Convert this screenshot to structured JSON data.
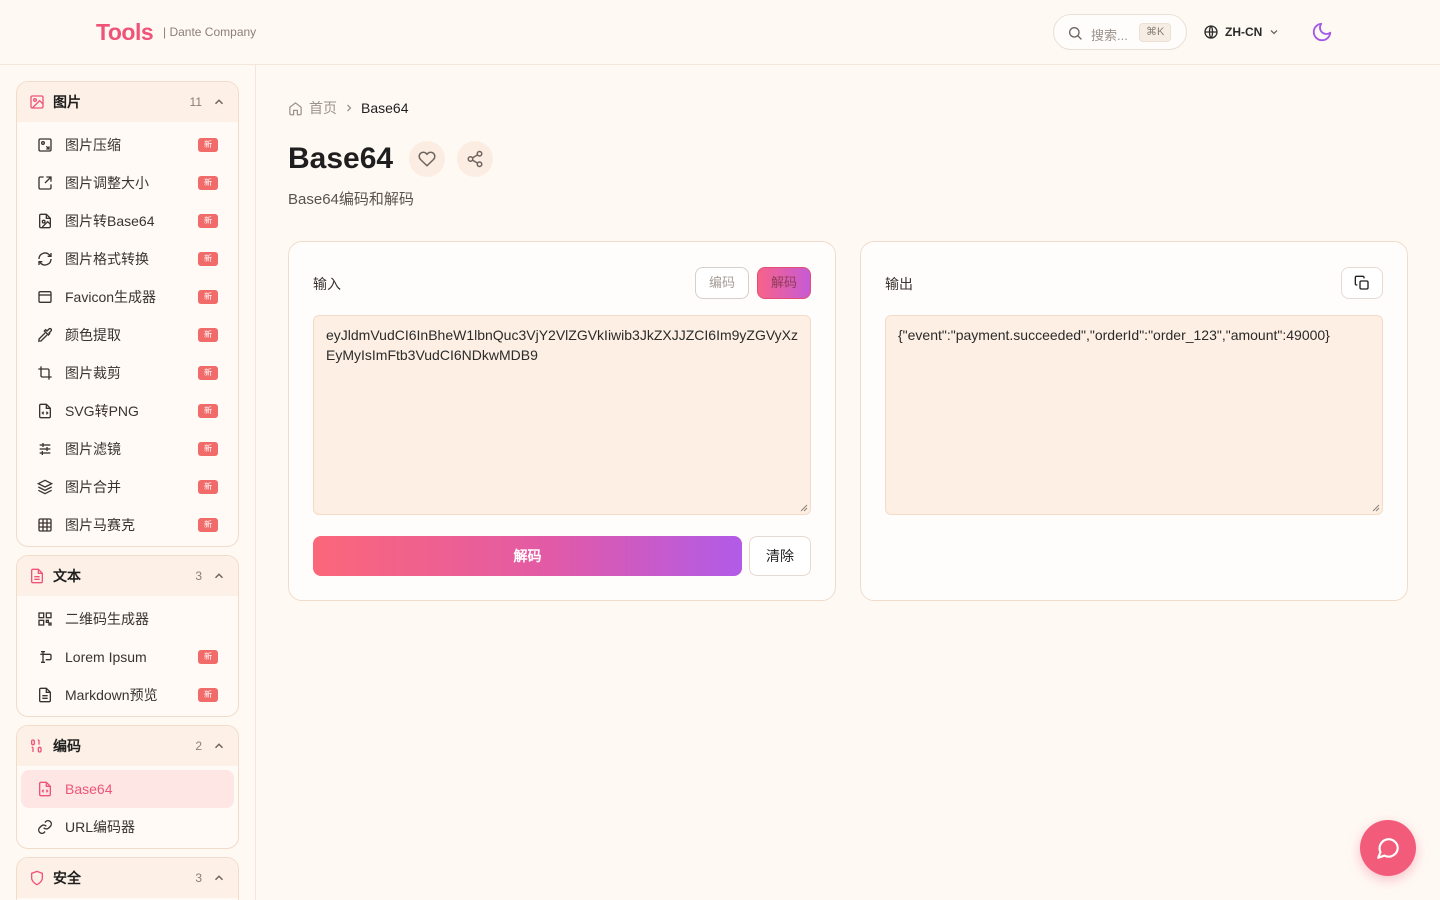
{
  "header": {
    "logo": "Tools",
    "company": "| Dante Company",
    "search_placeholder": "搜索...",
    "search_shortcut": "⌘K",
    "language": "ZH-CN"
  },
  "sidebar": {
    "groups": [
      {
        "title": "图片",
        "count": "11",
        "icon": "image-icon",
        "items": [
          {
            "label": "图片压缩",
            "badge": "新",
            "icon": "image-compress-icon"
          },
          {
            "label": "图片调整大小",
            "badge": "新",
            "icon": "resize-icon"
          },
          {
            "label": "图片转Base64",
            "badge": "新",
            "icon": "file-image-icon"
          },
          {
            "label": "图片格式转换",
            "badge": "新",
            "icon": "refresh-icon"
          },
          {
            "label": "Favicon生成器",
            "badge": "新",
            "icon": "browser-window-icon"
          },
          {
            "label": "颜色提取",
            "badge": "新",
            "icon": "eyedropper-icon"
          },
          {
            "label": "图片裁剪",
            "badge": "新",
            "icon": "crop-icon"
          },
          {
            "label": "SVG转PNG",
            "badge": "新",
            "icon": "file-code-icon"
          },
          {
            "label": "图片滤镜",
            "badge": "新",
            "icon": "sliders-icon"
          },
          {
            "label": "图片合并",
            "badge": "新",
            "icon": "layers-icon"
          },
          {
            "label": "图片马赛克",
            "badge": "新",
            "icon": "grid-icon"
          }
        ]
      },
      {
        "title": "文本",
        "count": "3",
        "icon": "document-icon",
        "items": [
          {
            "label": "二维码生成器",
            "badge": "",
            "icon": "qr-code-icon"
          },
          {
            "label": "Lorem Ipsum",
            "badge": "新",
            "icon": "text-cursor-icon"
          },
          {
            "label": "Markdown预览",
            "badge": "新",
            "icon": "file-text-icon"
          }
        ]
      },
      {
        "title": "编码",
        "count": "2",
        "icon": "binary-icon",
        "items": [
          {
            "label": "Base64",
            "badge": "",
            "icon": "file-code-icon",
            "active": true
          },
          {
            "label": "URL编码器",
            "badge": "",
            "icon": "link-icon"
          }
        ]
      },
      {
        "title": "安全",
        "count": "3",
        "icon": "shield-icon",
        "items": []
      }
    ]
  },
  "breadcrumb": {
    "home": "首页",
    "current": "Base64"
  },
  "page": {
    "title": "Base64",
    "subtitle": "Base64编码和解码"
  },
  "input_card": {
    "label": "输入",
    "encode_label": "编码",
    "decode_label": "解码",
    "value": "eyJldmVudCI6InBheW1lbnQuc3VjY2VlZGVkIiwib3JkZXJJZCI6Im9yZGVyXzEyMyIsImFtb3VudCI6NDkwMDB9",
    "action_label": "解码",
    "clear_label": "清除"
  },
  "output_card": {
    "label": "输出",
    "value": "{\"event\":\"payment.succeeded\",\"orderId\":\"order_123\",\"amount\":49000}"
  },
  "colors": {
    "accent": "#ef5478",
    "badge": "#f26b6b",
    "gradient_start": "#fb6779",
    "gradient_end": "#b15be8"
  }
}
